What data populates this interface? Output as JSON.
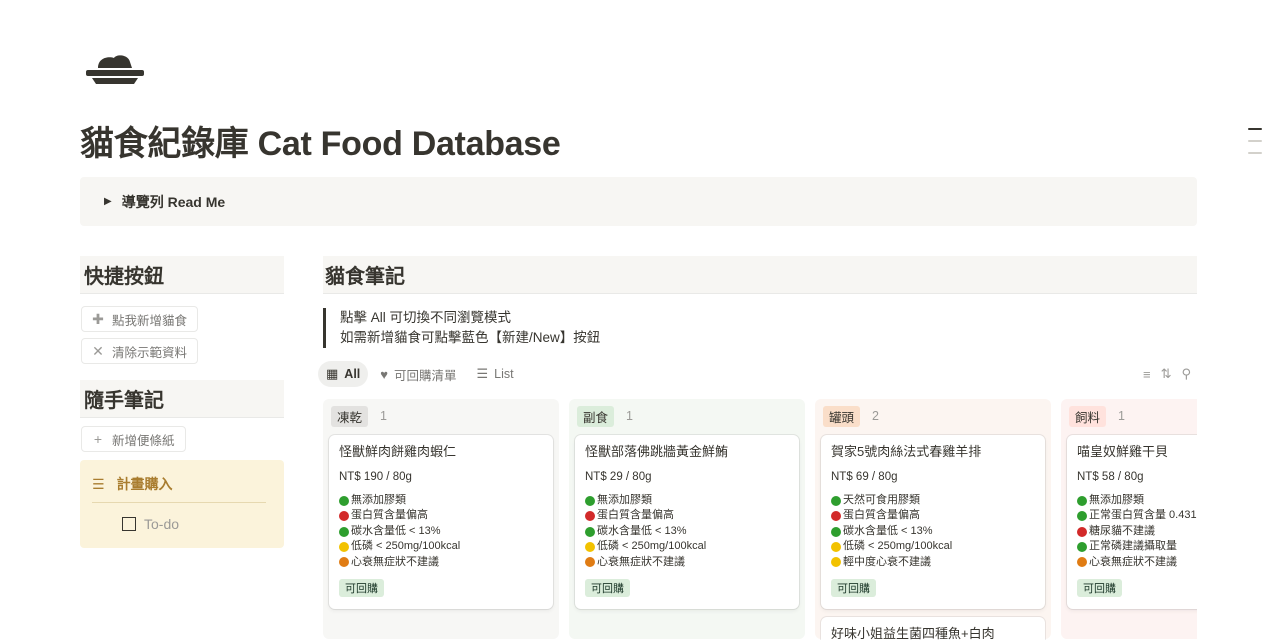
{
  "page": {
    "title": "貓食紀錄庫 Cat Food Database",
    "icon": "cat-food-bowl-icon"
  },
  "toggle": {
    "label": "導覽列 Read Me"
  },
  "sidebar": {
    "quick_heading": "快捷按鈕",
    "buttons": [
      {
        "label": "點我新增貓食",
        "icon": "plus-icon"
      },
      {
        "label": "清除示範資料",
        "icon": "close-icon"
      }
    ],
    "notes_heading": "隨手筆記",
    "add_note_label": "新增便條紙",
    "callout": {
      "title": "計畫購入",
      "todo": "To-do"
    }
  },
  "main": {
    "heading": "貓食筆記",
    "quote_lines": [
      "點擊 All 可切換不同瀏覽模式",
      "如需新增貓食可點擊藍色【新建/New】按鈕"
    ],
    "tabs": [
      {
        "label": "All",
        "icon": "grid-icon",
        "active": true
      },
      {
        "label": "可回購清單",
        "icon": "heart-icon",
        "active": false
      },
      {
        "label": "List",
        "icon": "list-icon",
        "active": false
      }
    ]
  },
  "colors": {
    "green": "#2e9e2e",
    "red": "#d22a2a",
    "yellow": "#f2c200",
    "orange": "#e07c14"
  },
  "board": {
    "columns": [
      {
        "name": "凍乾",
        "count": "1",
        "tag_color": "#e3e2e0",
        "bg": "#f7f7f5",
        "cards": [
          {
            "title": "怪獸鮮肉餅雞肉蝦仁",
            "price": "NT$ 190 / 80g",
            "features": [
              {
                "dot": "green",
                "text": "無添加膠類"
              },
              {
                "dot": "red",
                "text": "蛋白質含量偏高"
              },
              {
                "dot": "green",
                "text": "碳水含量低 < 13%"
              },
              {
                "dot": "yellow",
                "text": "低磷 < 250mg/100kcal"
              },
              {
                "dot": "orange",
                "text": "心衰無症狀不建議"
              }
            ],
            "badge": "可回購"
          }
        ]
      },
      {
        "name": "副食",
        "count": "1",
        "tag_color": "#dbeddb",
        "bg": "#f4f8f3",
        "cards": [
          {
            "title": "怪獸部落佛跳牆黃金鮮鮪",
            "price": "NT$ 29 / 80g",
            "features": [
              {
                "dot": "green",
                "text": "無添加膠類"
              },
              {
                "dot": "red",
                "text": "蛋白質含量偏高"
              },
              {
                "dot": "green",
                "text": "碳水含量低 < 13%"
              },
              {
                "dot": "yellow",
                "text": "低磷 < 250mg/100kcal"
              },
              {
                "dot": "orange",
                "text": "心衰無症狀不建議"
              }
            ],
            "badge": "可回購"
          }
        ]
      },
      {
        "name": "罐頭",
        "count": "2",
        "tag_color": "#fadec9",
        "bg": "#fcf5f1",
        "cards": [
          {
            "title": "賀家5號肉絲法式春雞羊排",
            "price": "NT$ 69 / 80g",
            "features": [
              {
                "dot": "green",
                "text": "天然可食用膠類"
              },
              {
                "dot": "red",
                "text": "蛋白質含量偏高"
              },
              {
                "dot": "green",
                "text": "碳水含量低 < 13%"
              },
              {
                "dot": "yellow",
                "text": "低磷 < 250mg/100kcal"
              },
              {
                "dot": "yellow",
                "text": "輕中度心衰不建議"
              }
            ],
            "badge": "可回購"
          },
          {
            "title": "好味小姐益生菌四種魚+白肉"
          }
        ]
      },
      {
        "name": "飼料",
        "count": "1",
        "tag_color": "#ffe2dd",
        "bg": "#fdf3f2",
        "cards": [
          {
            "title": "喵皇奴鮮雞干貝",
            "price": "NT$ 58 / 80g",
            "features": [
              {
                "dot": "green",
                "text": "無添加膠類"
              },
              {
                "dot": "green",
                "text": "正常蛋白質含量 0.431"
              },
              {
                "dot": "red",
                "text": "糖尿貓不建議"
              },
              {
                "dot": "green",
                "text": "正常磷建議攝取量"
              },
              {
                "dot": "orange",
                "text": "心衰無症狀不建議"
              }
            ],
            "badge": "可回購"
          }
        ]
      }
    ]
  }
}
